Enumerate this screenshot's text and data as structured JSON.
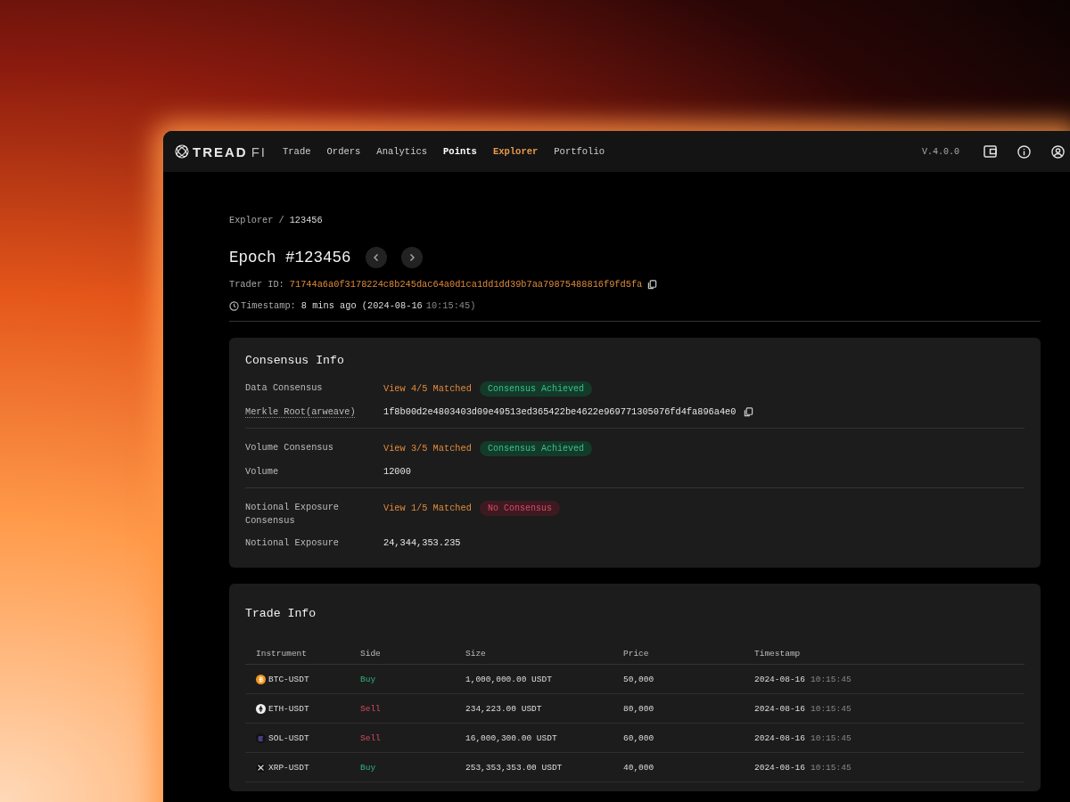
{
  "nav": {
    "logo": {
      "word": "TREAD",
      "suffix": "FI"
    },
    "items": [
      {
        "label": "Trade",
        "selected": false,
        "emphasized": false
      },
      {
        "label": "Orders",
        "selected": false,
        "emphasized": false
      },
      {
        "label": "Analytics",
        "selected": false,
        "emphasized": false
      },
      {
        "label": "Points",
        "selected": false,
        "emphasized": true
      },
      {
        "label": "Explorer",
        "selected": true,
        "emphasized": false
      },
      {
        "label": "Portfolio",
        "selected": false,
        "emphasized": false
      }
    ],
    "version": "V.4.0.0"
  },
  "breadcrumb": {
    "parent": "Explorer",
    "separator": "/",
    "current": "123456"
  },
  "epoch": {
    "title": "Epoch #123456",
    "trader_id": {
      "label": "Trader ID:",
      "value": "71744a6a0f3178224c8b245dac64a0d1ca1dd1dd39b7aa79875488816f9fd5fa"
    },
    "timestamp": {
      "label": "Timestamp:",
      "relative": "8 mins ago (2024-08-16",
      "time": "10:15:45)"
    }
  },
  "consensus_info": {
    "title": "Consensus Info",
    "groups": [
      {
        "items": [
          {
            "kind": "consensus",
            "label": "Data Consensus",
            "link": "View 4/5 Matched",
            "badge": {
              "label": "Consensus Achieved",
              "achieved": true
            }
          },
          {
            "kind": "hash",
            "label": "Merkle Root(arweave)",
            "value": "1f8b00d2e4803403d09e49513ed365422be4622e969771305076fd4fa896a4e0"
          }
        ]
      },
      {
        "items": [
          {
            "kind": "consensus",
            "label": "Volume Consensus",
            "link": "View 3/5 Matched",
            "badge": {
              "label": "Consensus Achieved",
              "achieved": true
            }
          },
          {
            "kind": "value",
            "label": "Volume",
            "value": "12000"
          }
        ]
      },
      {
        "items": [
          {
            "kind": "consensus",
            "label": "Notional Exposure Consensus",
            "link": "View 1/5 Matched",
            "badge": {
              "label": "No Consensus",
              "achieved": false
            }
          },
          {
            "kind": "value",
            "label": "Notional Exposure",
            "value": "24,344,353.235"
          }
        ]
      }
    ]
  },
  "trade_info": {
    "title": "Trade Info",
    "columns": [
      "Instrument",
      "Side",
      "Size",
      "Price",
      "Timestamp"
    ],
    "rows": [
      {
        "kind": "btc",
        "instrument": "BTC-USDT",
        "side": {
          "label": "Buy",
          "kind": "buy"
        },
        "size": "1,000,000.00 USDT",
        "price": "50,000",
        "date": "2024-08-16",
        "time": "10:15:45"
      },
      {
        "kind": "eth",
        "instrument": "ETH-USDT",
        "side": {
          "label": "Sell",
          "kind": "sell"
        },
        "size": "234,223.00 USDT",
        "price": "80,000",
        "date": "2024-08-16",
        "time": "10:15:45"
      },
      {
        "kind": "sol",
        "instrument": "SOL-USDT",
        "side": {
          "label": "Sell",
          "kind": "sell"
        },
        "size": "16,000,300.00 USDT",
        "price": "60,000",
        "date": "2024-08-16",
        "time": "10:15:45"
      },
      {
        "kind": "xrp",
        "instrument": "XRP-USDT",
        "side": {
          "label": "Buy",
          "kind": "buy"
        },
        "size": "253,353,353.00 USDT",
        "price": "40,000",
        "date": "2024-08-16",
        "time": "10:15:45"
      }
    ]
  }
}
